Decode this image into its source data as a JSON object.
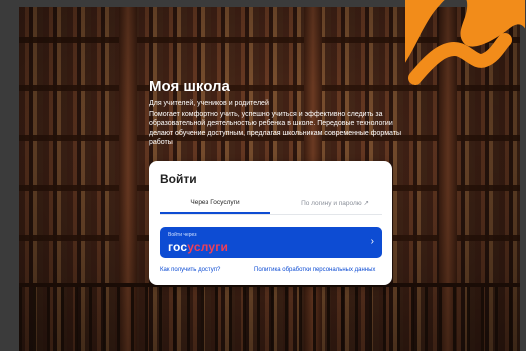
{
  "hero": {
    "title": "Моя школа",
    "subtitle": "Для учителей, учеников и родителей",
    "description": "Помогает комфортно учить, успешно учиться и эффективно следить за образовательной деятельностью ребенка в школе. Передовые технологии делают обучение доступным, предлагая школьникам современные форматы работы"
  },
  "login_card": {
    "title": "Войти",
    "tabs": [
      {
        "label": "Через Госуслуги",
        "active": true
      },
      {
        "label": "По логину и паролю ↗",
        "active": false
      }
    ],
    "gosuslugi_button": {
      "caption": "Войти через",
      "logo_part1": "гос",
      "logo_part2": "услуги",
      "chevron": "›"
    },
    "links": {
      "access": "Как получить доступ?",
      "policy": "Политика обработки персональных данных"
    }
  },
  "colors": {
    "accent_blue": "#0d4cd3",
    "gosuslugi_red": "#ee3f58",
    "brand_orange": "#f28c1a"
  },
  "icons": {
    "tab_external": "external-link-icon",
    "button_chevron": "chevron-right-icon",
    "brand_blob": "orange-brand-shape-icon"
  }
}
